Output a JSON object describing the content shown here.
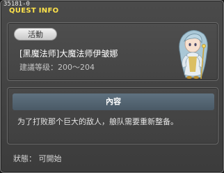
{
  "window": {
    "quest_id": "35181-0",
    "title": "QUEST INFO"
  },
  "info": {
    "category_tag": "活動",
    "quest_name": "[黑魔法师]大魔法师伊皱娜",
    "recommended_level": "建議等级：200～204",
    "npc_icon": "npc-portrait-icon"
  },
  "content": {
    "header": "內容",
    "description": "为了打败那个巨大的敌人，艆队需要重新整备。"
  },
  "status": {
    "text": "狀態： 可開始"
  },
  "colors": {
    "title": "#ffe34a",
    "header_bar": "#566874",
    "panel_bg": "#464646"
  }
}
